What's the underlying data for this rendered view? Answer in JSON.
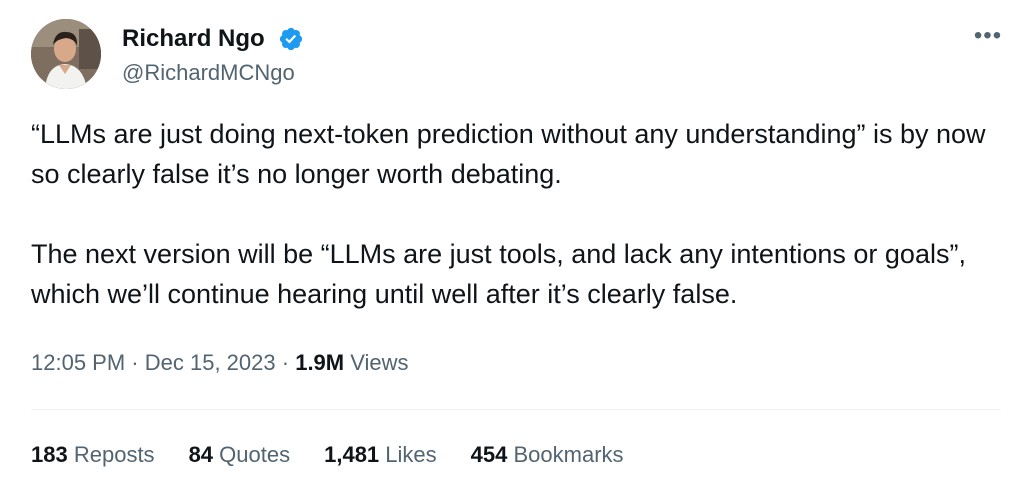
{
  "author": {
    "name": "Richard Ngo",
    "handle": "@RichardMCNgo",
    "verified_color": "#1d9bf0"
  },
  "more_icon": "more-horizontal-icon",
  "tweet": {
    "paragraphs": [
      "“LLMs are just doing next-token prediction without any understanding” is by now so clearly false it’s no longer worth debating.",
      "The next version will be “LLMs are just tools, and lack any intentions or goals”, which we’ll continue hearing until well after it’s clearly false."
    ]
  },
  "meta": {
    "time": "12:05 PM",
    "separator": "·",
    "date": "Dec 15, 2023",
    "views_count": "1.9M",
    "views_label": "Views"
  },
  "stats": [
    {
      "count": "183",
      "label": "Reposts"
    },
    {
      "count": "84",
      "label": "Quotes"
    },
    {
      "count": "1,481",
      "label": "Likes"
    },
    {
      "count": "454",
      "label": "Bookmarks"
    }
  ]
}
